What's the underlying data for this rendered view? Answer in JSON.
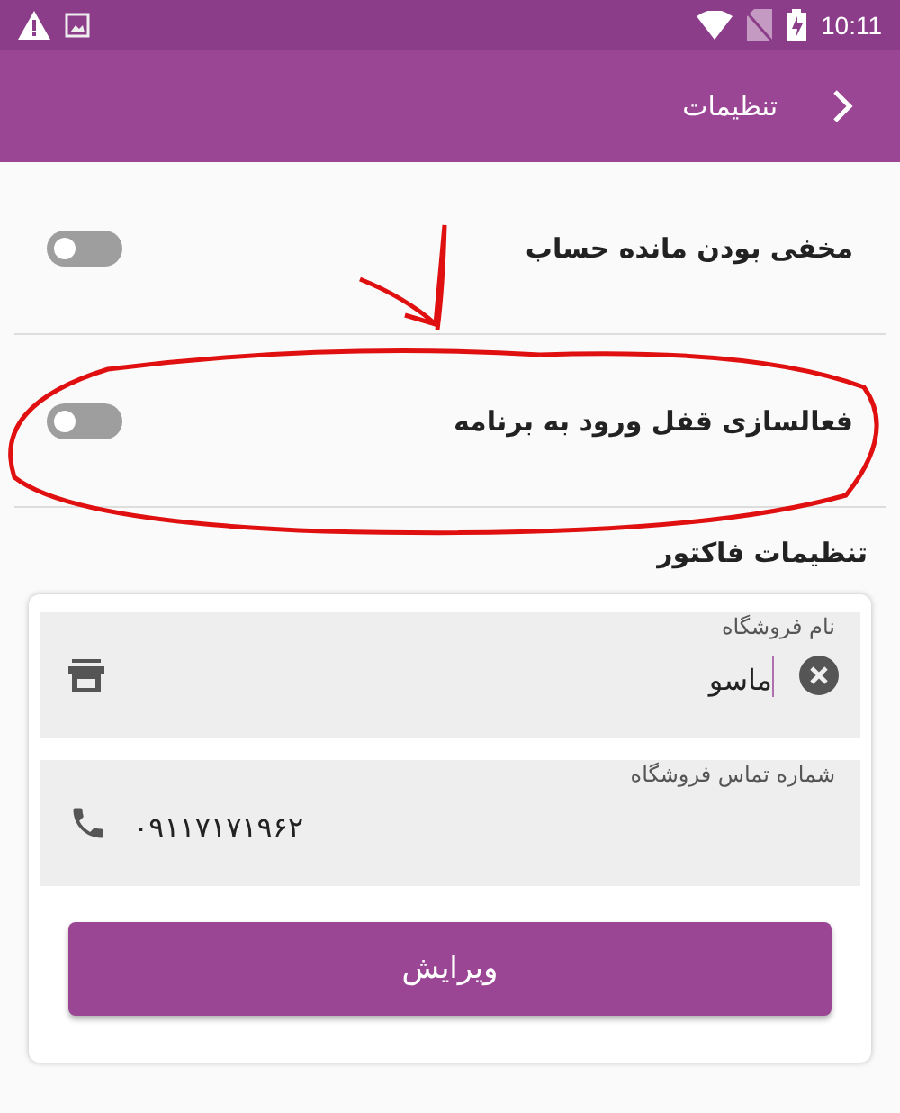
{
  "status_bar": {
    "time": "10:11"
  },
  "app_bar": {
    "title": "تنظیمات"
  },
  "settings": [
    {
      "label": "مخفی بودن مانده حساب",
      "on": false
    },
    {
      "label": "فعالسازی قفل ورود به برنامه",
      "on": false
    }
  ],
  "invoice_section": {
    "title": "تنظیمات فاکتور",
    "fields": [
      {
        "kind": "store",
        "label": "نام فروشگاه",
        "value": "ماسو",
        "focused": true
      },
      {
        "kind": "phone",
        "label": "شماره تماس فروشگاه",
        "value": "۰۹۱۱۷۱۷۱۹۶۲",
        "focused": false
      }
    ],
    "button": "ویرایش"
  }
}
